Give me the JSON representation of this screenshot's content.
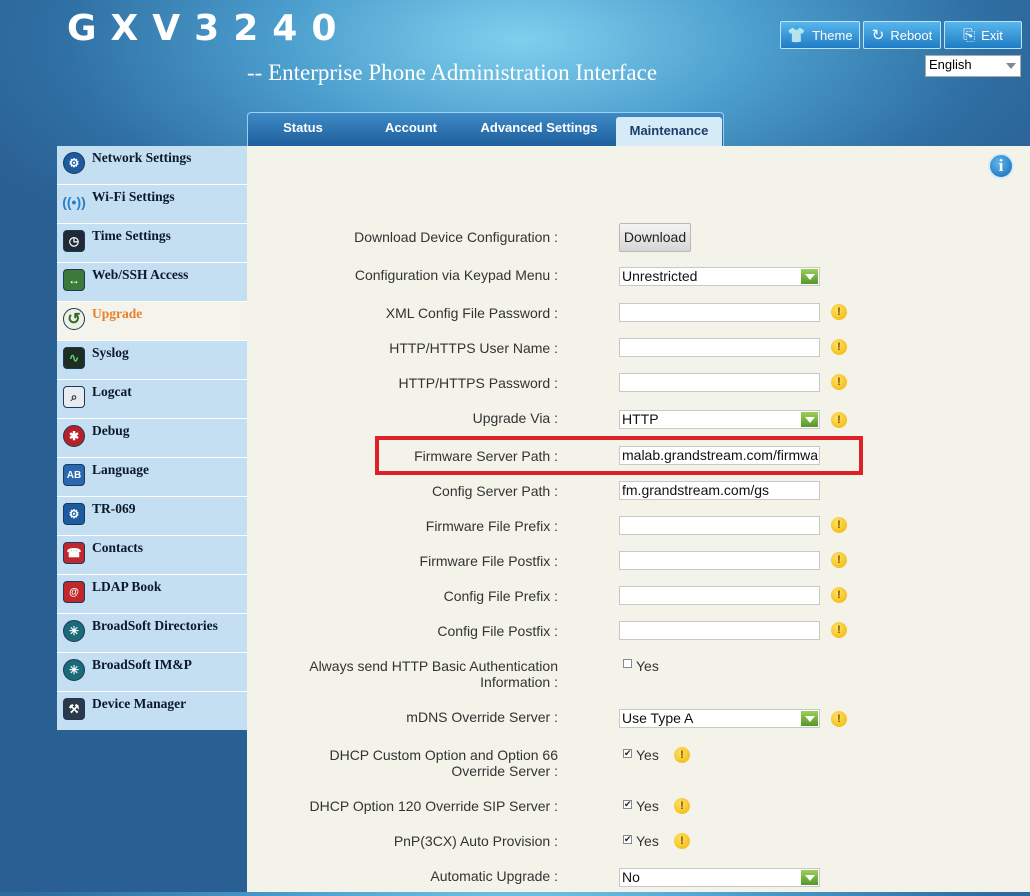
{
  "header": {
    "logo": "GXV3240",
    "subtitle": "-- Enterprise Phone Administration Interface",
    "buttons": {
      "theme": "Theme",
      "reboot": "Reboot",
      "exit": "Exit"
    },
    "language": "English"
  },
  "tabs": [
    "Status",
    "Account",
    "Advanced Settings",
    "Maintenance"
  ],
  "sidebar": {
    "items": [
      {
        "label": "Network Settings",
        "icon": "network-icon"
      },
      {
        "label": "Wi-Fi Settings",
        "icon": "wifi-icon"
      },
      {
        "label": "Time Settings",
        "icon": "clock-icon"
      },
      {
        "label": "Web/SSH Access",
        "icon": "monitor-icon"
      },
      {
        "label": "Upgrade",
        "icon": "upgrade-icon"
      },
      {
        "label": "Syslog",
        "icon": "syslog-icon"
      },
      {
        "label": "Logcat",
        "icon": "magnifier-icon"
      },
      {
        "label": "Debug",
        "icon": "bug-icon"
      },
      {
        "label": "Language",
        "icon": "language-icon"
      },
      {
        "label": "TR-069",
        "icon": "tr069-icon"
      },
      {
        "label": "Contacts",
        "icon": "contacts-icon"
      },
      {
        "label": "LDAP Book",
        "icon": "ldap-book-icon"
      },
      {
        "label": "BroadSoft Directories",
        "icon": "broadsoft-icon"
      },
      {
        "label": "BroadSoft IM&P",
        "icon": "broadsoft-imp-icon"
      },
      {
        "label": "Device Manager",
        "icon": "device-manager-icon"
      }
    ]
  },
  "form": {
    "download_device_config": {
      "label": "Download Device Configuration :",
      "button": "Download"
    },
    "config_keypad_menu": {
      "label": "Configuration via Keypad Menu :",
      "value": "Unrestricted"
    },
    "xml_config_password": {
      "label": "XML Config File Password :",
      "value": ""
    },
    "http_user_name": {
      "label": "HTTP/HTTPS User Name :",
      "value": ""
    },
    "http_password": {
      "label": "HTTP/HTTPS Password :",
      "value": ""
    },
    "upgrade_via": {
      "label": "Upgrade Via :",
      "value": "HTTP"
    },
    "firmware_server_path": {
      "label": "Firmware Server Path :",
      "value": "malab.grandstream.com/firmware/("
    },
    "config_server_path": {
      "label": "Config Server Path :",
      "value": "fm.grandstream.com/gs"
    },
    "firmware_prefix": {
      "label": "Firmware File Prefix :",
      "value": ""
    },
    "firmware_postfix": {
      "label": "Firmware File Postfix :",
      "value": ""
    },
    "config_prefix": {
      "label": "Config File Prefix :",
      "value": ""
    },
    "config_postfix": {
      "label": "Config File Postfix :",
      "value": ""
    },
    "http_basic_auth": {
      "label1": "Always send HTTP Basic Authentication",
      "label2": "Information :",
      "option": "Yes",
      "checked": false
    },
    "mdns_override": {
      "label": "mDNS Override Server :",
      "value": "Use Type A"
    },
    "dhcp_option66": {
      "label1": "DHCP Custom Option and Option 66",
      "label2": "Override Server :",
      "option": "Yes",
      "checked": true
    },
    "dhcp_option120": {
      "label": "DHCP Option 120 Override SIP Server :",
      "option": "Yes",
      "checked": true
    },
    "pnp_3cx": {
      "label": "PnP(3CX) Auto Provision :",
      "option": "Yes",
      "checked": true
    },
    "automatic_upgrade": {
      "label": "Automatic Upgrade :",
      "value": "No"
    }
  },
  "colors": {
    "active_sidebar_text": "#e8802a",
    "highlight_box": "#e02028",
    "warning": "#f0b400"
  }
}
